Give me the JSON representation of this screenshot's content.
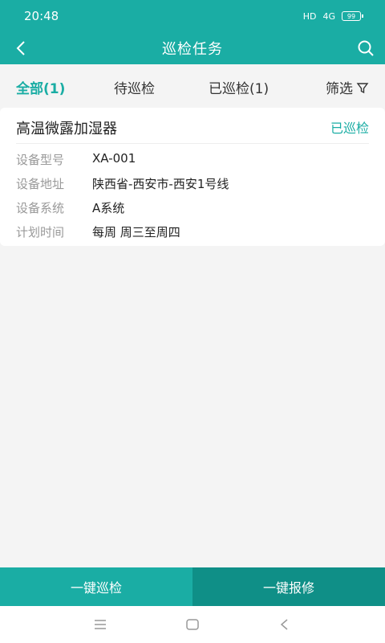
{
  "status_bar": {
    "time": "20:48",
    "hd": "HD",
    "signal": "4G",
    "battery": "99"
  },
  "nav": {
    "title": "巡检任务"
  },
  "tabs": [
    {
      "label": "全部(1)",
      "active": true
    },
    {
      "label": "待巡检",
      "active": false
    },
    {
      "label": "已巡检(1)",
      "active": false
    }
  ],
  "filter": {
    "label": "筛选"
  },
  "task": {
    "name": "高温微露加湿器",
    "status": "已巡检",
    "fields": [
      {
        "label": "设备型号",
        "value": "XA-001"
      },
      {
        "label": "设备地址",
        "value": "陕西省-西安市-西安1号线"
      },
      {
        "label": "设备系统",
        "value": "A系统"
      },
      {
        "label": "计划时间",
        "value": "每周 周三至周四"
      }
    ]
  },
  "actions": {
    "inspect_label": "一键巡检",
    "repair_label": "一键报修"
  },
  "colors": {
    "accent": "#1aada4"
  }
}
